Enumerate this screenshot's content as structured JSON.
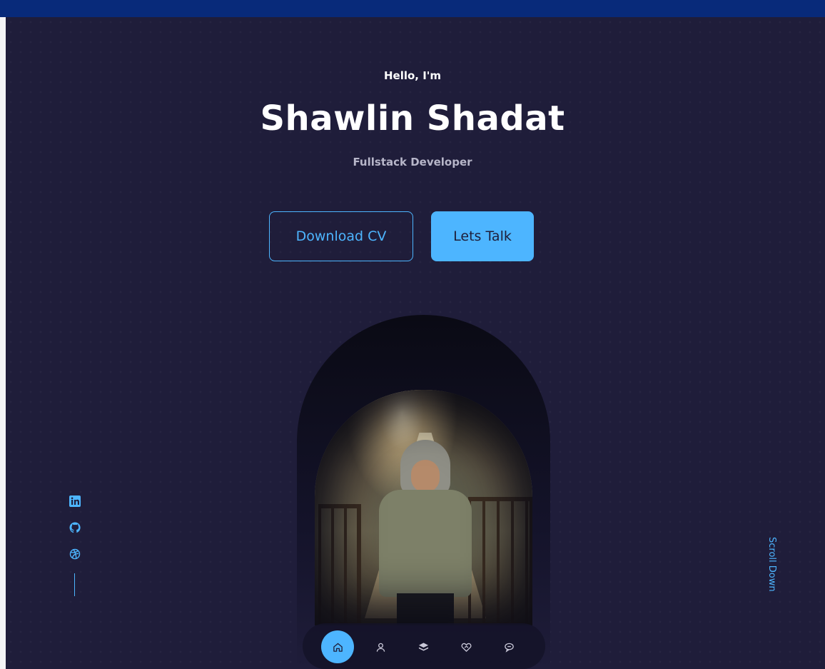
{
  "hero": {
    "greeting": "Hello, I'm",
    "name": "Shawlin Shadat",
    "role": "Fullstack Developer",
    "download_cv_label": "Download CV",
    "lets_talk_label": "Lets Talk",
    "scroll_down_label": "Scroll Down"
  },
  "socials": [
    {
      "icon": "linkedin-icon"
    },
    {
      "icon": "github-icon"
    },
    {
      "icon": "dribbble-icon"
    }
  ],
  "nav": {
    "items": [
      {
        "icon": "home-icon",
        "active": true
      },
      {
        "icon": "user-icon",
        "active": false
      },
      {
        "icon": "layers-icon",
        "active": false
      },
      {
        "icon": "services-icon",
        "active": false
      },
      {
        "icon": "message-icon",
        "active": false
      }
    ]
  },
  "colors": {
    "background": "#1f1d3a",
    "accent": "#4db5ff",
    "topbar": "#082a7a"
  }
}
